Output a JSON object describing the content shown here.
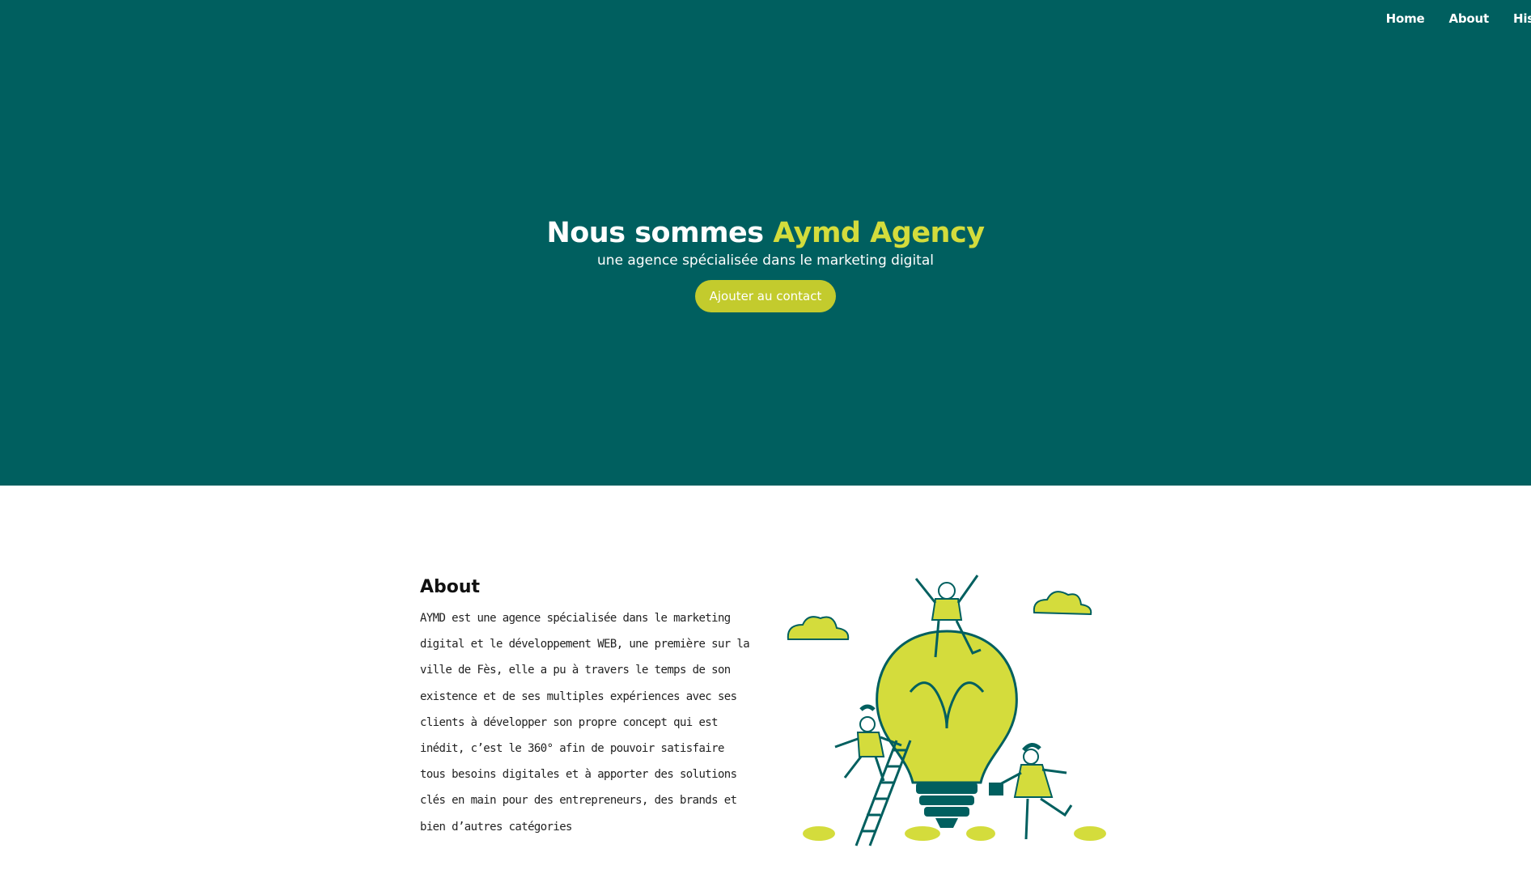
{
  "nav": {
    "items": [
      "Home",
      "About",
      "His"
    ]
  },
  "hero": {
    "title_prefix": "Nous sommes ",
    "title_accent": "Aymd Agency",
    "subtitle": "une agence spécialisée dans le marketing digital",
    "cta_label": "Ajouter au contact"
  },
  "about": {
    "heading": "About",
    "body": "AYMD est une agence spécialisée dans le marketing digital et le développement WEB, une première sur la ville de Fès, elle a pu à travers le temps de son existence et de ses multiples expériences avec ses clients à développer son propre concept qui est inédit, c’est le 360° afin de pouvoir satisfaire tous besoins digitales et à apporter des solutions clés en main pour des entrepreneurs, des brands et bien d’autres catégories"
  },
  "colors": {
    "hero_bg": "#005f5f",
    "accent": "#d4dc3c",
    "button_bg": "#c3cb2d"
  },
  "illustration": {
    "icon": "lightbulb-people-illustration"
  }
}
